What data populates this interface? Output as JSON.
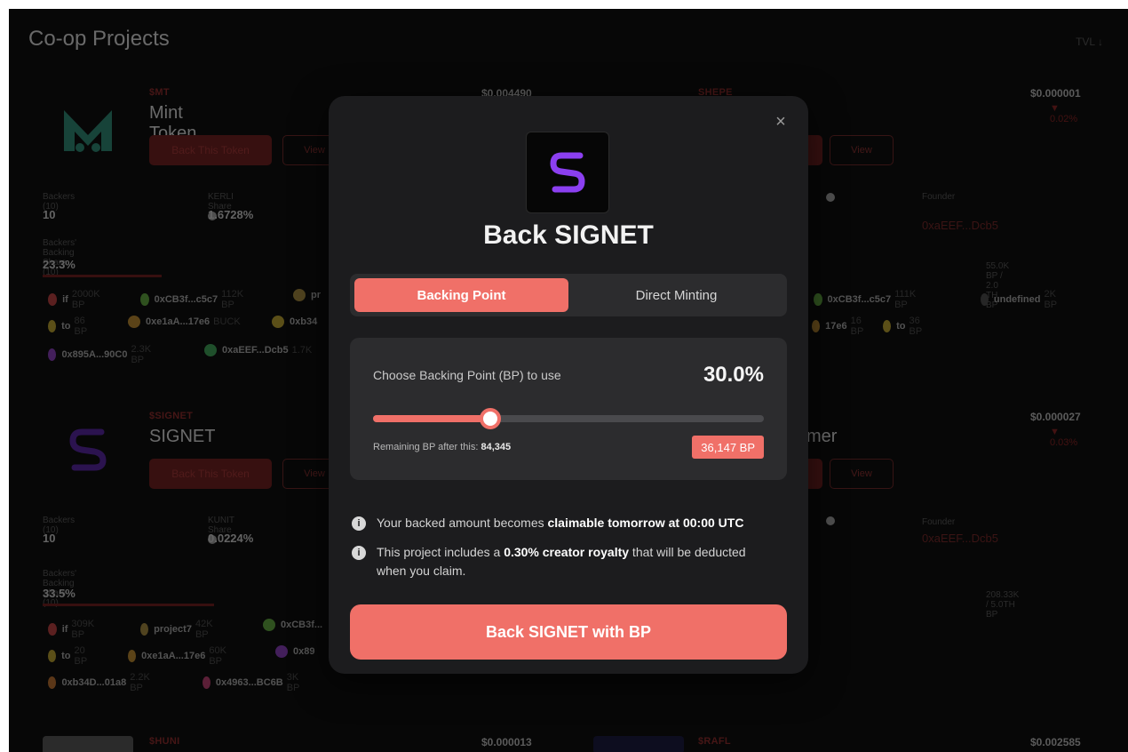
{
  "page": {
    "title": "Co-op Projects",
    "tvl": "TVL ↓"
  },
  "cards": {
    "mint": {
      "ticker": "$MT",
      "name": "Mint Token",
      "price": "$0.004490",
      "back_label": "Back This Token",
      "view_label": "View",
      "backers_label": "Backers (10)",
      "backers_value": "10",
      "share_label": "KERLI Share",
      "share_value": "1.6728%",
      "backing_share_label": "Backers' Backing Share (10)",
      "backing_share_value": "23.3%",
      "backing_share_fraction": 0.233,
      "chips": [
        {
          "name": "if",
          "bp": "2000K BP",
          "color": "#7a2b2b"
        },
        {
          "name": "0xCB3f...c5c7",
          "bp": "112K BP",
          "color": "#3f6d2a"
        },
        {
          "name": "pr",
          "bp": "",
          "color": "#6b5a2a"
        },
        {
          "name": "to",
          "bp": "86 BP",
          "color": "#7a6a20"
        },
        {
          "name": "0xe1aA...17e6",
          "bp": "BUCK",
          "color": "#7a5a20"
        },
        {
          "name": "0xb34",
          "bp": "",
          "color": "#7a6a20"
        },
        {
          "name": "0x895A...90C0",
          "bp": "2.3K BP",
          "color": "#5a2a7a"
        },
        {
          "name": "0xaEEF...Dcb5",
          "bp": "1.7K",
          "color": "#2a6a3a"
        }
      ]
    },
    "shepe": {
      "ticker": "SHEPE",
      "price": "$0.000001",
      "change": "▼ 0.02%",
      "view_label": "View",
      "founder_label": "Founder",
      "founder_value": "0xaEEF...Dcb5",
      "bp_summary": "55.0K BP / 2.0 TH BP",
      "chips": [
        {
          "name": "0xCB3f...c5c7",
          "bp": "111K BP",
          "color": "#3f6d2a"
        },
        {
          "name": "undefined",
          "bp": "2K BP",
          "color": "#333333"
        },
        {
          "name": "17e6",
          "bp": "16 BP",
          "color": "#7a5a20"
        },
        {
          "name": "to",
          "bp": "36 BP",
          "color": "#7a6a20"
        }
      ]
    },
    "signet": {
      "ticker": "$SIGNET",
      "name": "SIGNET",
      "back_label": "Back This Token",
      "view_label": "View",
      "backers_label": "Backers (10)",
      "backers_value": "10",
      "share_label": "KUNIT Share",
      "share_value": "0.0224%",
      "backing_share_label": "Backers' Backing Share (10)",
      "backing_share_value": "33.5%",
      "backing_share_fraction": 0.335,
      "chips": [
        {
          "name": "if",
          "bp": "309K BP",
          "color": "#7a2b2b"
        },
        {
          "name": "project7",
          "bp": "42K BP",
          "color": "#6b5a2a"
        },
        {
          "name": "0xCB3f...",
          "bp": "",
          "color": "#3f6d2a"
        },
        {
          "name": "to",
          "bp": "20 BP",
          "color": "#7a6a20"
        },
        {
          "name": "0xe1aA...17e6",
          "bp": "60K BP",
          "color": "#7a5a20"
        },
        {
          "name": "0x89",
          "bp": "",
          "color": "#5a2a7a"
        },
        {
          "name": "0xb34D...01a8",
          "bp": "2.2K BP",
          "color": "#7a4a20"
        },
        {
          "name": "0x4963...BC6B",
          "bp": "3K BP",
          "color": "#7a2a4a"
        }
      ]
    },
    "right2": {
      "name_partial": "mer",
      "price": "$0.000027",
      "change": "▼ 0.03%",
      "view_label": "View",
      "founder_label": "Founder",
      "founder_value": "0xaEEF...Dcb5",
      "bp_summary": "208.33K / 5.0TH BP"
    },
    "bottom": {
      "ticker_left": "$HUNI",
      "price_left": "$0.000013",
      "ticker_right": "$RAFL",
      "price_right": "$0.002585"
    }
  },
  "modal": {
    "title": "Back SIGNET",
    "close_glyph": "×",
    "tabs": [
      {
        "label": "Backing Point",
        "active": true
      },
      {
        "label": "Direct Minting",
        "active": false
      }
    ],
    "slider": {
      "label": "Choose Backing Point (BP) to use",
      "percent_label": "30.0%",
      "fraction": 0.3,
      "remaining_prefix": "Remaining BP after this:",
      "remaining_value": "84,345",
      "bp_amount": "36,147 BP"
    },
    "info": [
      {
        "pre": "Your backed amount becomes ",
        "bold": "claimable tomorrow at 00:00 UTC",
        "post": ""
      },
      {
        "pre": "This project includes a ",
        "bold": "0.30% creator royalty",
        "post": " that will be deducted when you claim."
      }
    ],
    "cta_label": "Back SIGNET with BP",
    "colors": {
      "accent": "#f07068",
      "panel": "#2c2c2e",
      "modal": "#1c1c1e"
    }
  }
}
